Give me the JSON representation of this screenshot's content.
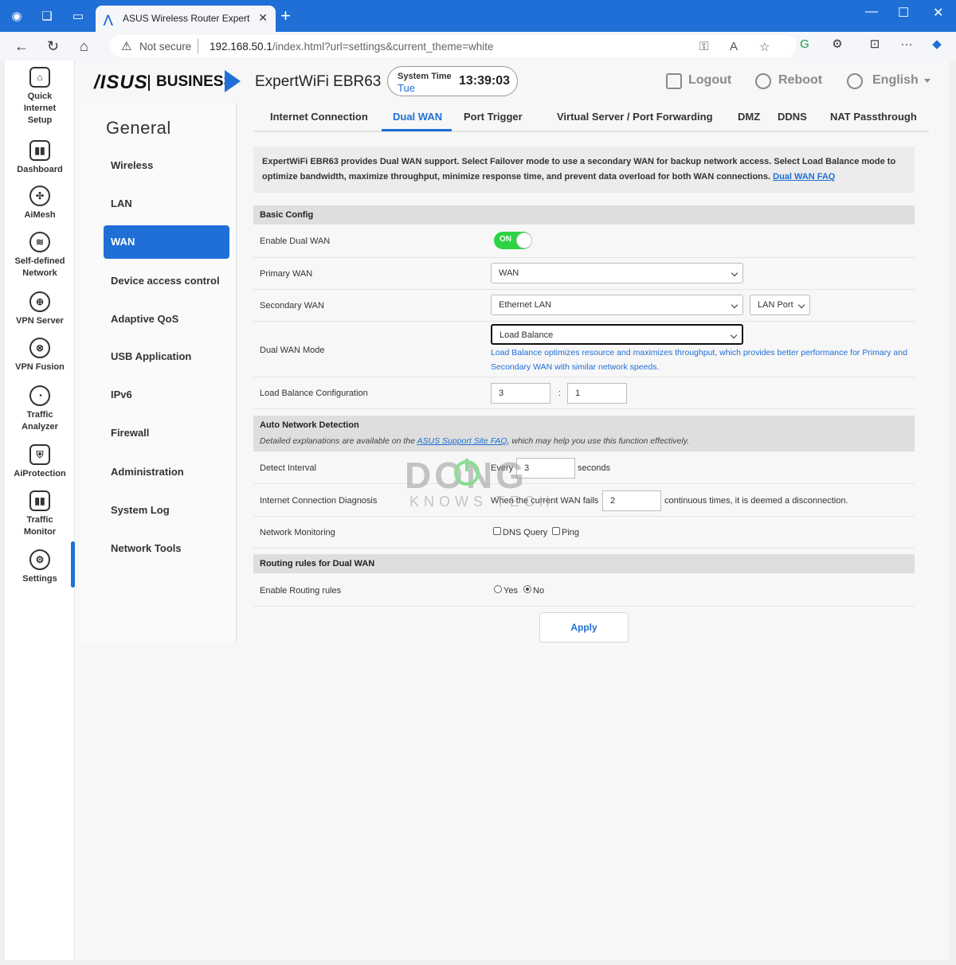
{
  "browser": {
    "tab_title": "ASUS Wireless Router ExpertWiFi",
    "tab_close": "✕",
    "new_tab": "+",
    "not_secure": "Not secure",
    "url_host": "192.168.50.1",
    "url_path": "/index.html?url=settings&current_theme=white",
    "window_min": "—",
    "window_max": "☐",
    "window_close": "✕",
    "more_menu": "···"
  },
  "rail": {
    "items": [
      {
        "label": "Quick Internet Setup",
        "icon": "quick-setup-icon"
      },
      {
        "label": "Dashboard",
        "icon": "dashboard-icon"
      },
      {
        "label": "AiMesh",
        "icon": "aimesh-icon"
      },
      {
        "label": "Self-defined Network",
        "icon": "network-icon"
      },
      {
        "label": "VPN Server",
        "icon": "vpn-server-icon"
      },
      {
        "label": "VPN Fusion",
        "icon": "vpn-fusion-icon"
      },
      {
        "label": "Traffic Analyzer",
        "icon": "traffic-analyzer-icon"
      },
      {
        "label": "AiProtection",
        "icon": "aiprotection-icon"
      },
      {
        "label": "Traffic Monitor",
        "icon": "traffic-monitor-icon"
      },
      {
        "label": "Settings",
        "icon": "settings-icon"
      }
    ]
  },
  "header": {
    "brand_asus": "/ISUS",
    "brand_business": "BUSINESS",
    "model": "ExpertWiFi EBR63",
    "system_time_label": "System Time",
    "system_time_day": "Tue",
    "system_time_clock": "13:39:03",
    "logout": "Logout",
    "reboot": "Reboot",
    "language": "English"
  },
  "submenu": {
    "title": "General",
    "items": [
      "Wireless",
      "LAN",
      "WAN",
      "Device access control",
      "Adaptive QoS",
      "USB Application",
      "IPv6",
      "Firewall",
      "Administration",
      "System Log",
      "Network Tools"
    ],
    "active": "WAN"
  },
  "tabs": {
    "items": [
      "Internet Connection",
      "Dual WAN",
      "Port Trigger",
      "Virtual Server / Port Forwarding",
      "DMZ",
      "DDNS",
      "NAT Passthrough"
    ],
    "active": "Dual WAN"
  },
  "description": {
    "text": "ExpertWiFi EBR63 provides Dual WAN support. Select Failover mode to use a secondary WAN for backup network access. Select Load Balance mode to optimize bandwidth, maximize throughput, minimize response time, and prevent data overload for both WAN connections. ",
    "link": "Dual WAN FAQ"
  },
  "basic_config": {
    "heading": "Basic Config",
    "enable_label": "Enable Dual WAN",
    "enable_state": "ON",
    "primary_label": "Primary WAN",
    "primary_value": "WAN",
    "secondary_label": "Secondary WAN",
    "secondary_value": "Ethernet LAN",
    "secondary_port": "LAN Port",
    "mode_label": "Dual WAN Mode",
    "mode_value": "Load Balance",
    "mode_hint": "Load Balance optimizes resource and maximizes throughput, which provides better performance for Primary and Secondary WAN with similar network speeds.",
    "lb_label": "Load Balance Configuration",
    "lb_primary": "3",
    "lb_sep": ":",
    "lb_secondary": "1"
  },
  "auto_detection": {
    "heading": "Auto Network Detection",
    "note_prefix": "Detailed explanations are available on the ",
    "note_link": "ASUS Support Site FAQ",
    "note_suffix": ", which may help you use this function effectively.",
    "interval_label": "Detect Interval",
    "interval_prefix": "Every",
    "interval_value": "3",
    "interval_suffix": "seconds",
    "diag_label": "Internet Connection Diagnosis",
    "diag_prefix": "When the current WAN fails",
    "diag_value": "2",
    "diag_suffix": "continuous times, it is deemed a disconnection.",
    "monitor_label": "Network Monitoring",
    "monitor_dns": "DNS Query",
    "monitor_ping": "Ping"
  },
  "routing": {
    "heading": "Routing rules for Dual WAN",
    "enable_label": "Enable Routing rules",
    "yes": "Yes",
    "no": "No",
    "selected": "No"
  },
  "apply_label": "Apply",
  "watermark": {
    "big": "DONG",
    "small": "KNOWS TECH"
  },
  "colors": {
    "accent": "#1f6fd6",
    "toggle_on": "#2ed345",
    "titlebar": "#1f6fd6"
  }
}
